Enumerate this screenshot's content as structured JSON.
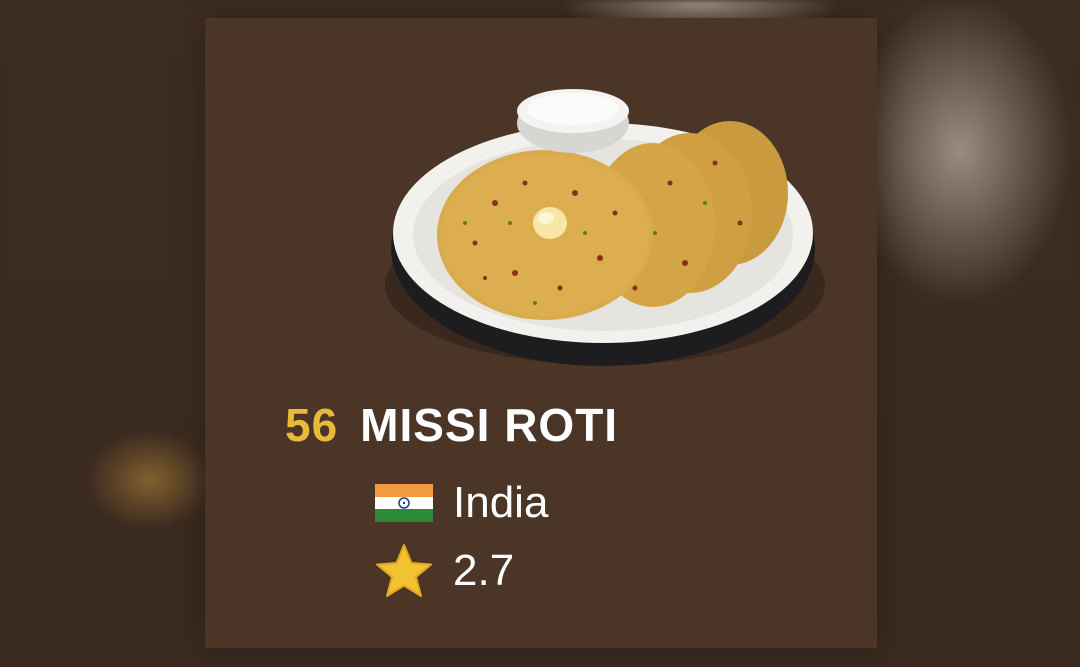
{
  "dish": {
    "rank": "56",
    "name": "MISSI ROTI",
    "country": "India",
    "rating": "2.7"
  },
  "icons": {
    "flag": "india-flag-icon",
    "star": "star-icon"
  },
  "colors": {
    "card_background": "#4a3527",
    "rank": "#e9b93c",
    "text": "#ffffff",
    "star": "#f2c230"
  }
}
